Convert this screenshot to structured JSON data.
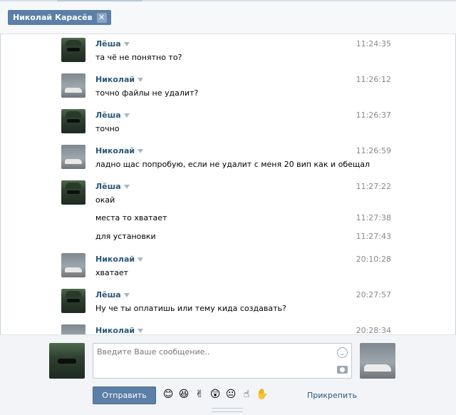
{
  "chat": {
    "tab_label": "Николай Карасёв",
    "close_glyph": "✕"
  },
  "messages": [
    {
      "author": "Лёша",
      "text": "та чё не понятно то?",
      "time": "11:24:35"
    },
    {
      "author": "Николай",
      "text": "точно файлы не удалит?",
      "time": "11:26:12"
    },
    {
      "author": "Лёша",
      "text": "точно",
      "time": "11:26:37"
    },
    {
      "author": "Николай",
      "text": "ладно щас попробую, если не удалит с меня 20 вип как и обещал",
      "time": "11:26:59"
    },
    {
      "author": "Лёша",
      "text": "окай",
      "time": "11:27:22"
    },
    {
      "author": "",
      "text": "места то хватает",
      "time": "11:27:38"
    },
    {
      "author": "",
      "text": "для установки",
      "time": "11:27:43"
    },
    {
      "author": "Николай",
      "text": "хватает",
      "time": "20:10:28"
    },
    {
      "author": "Лёша",
      "text": "Ну че ты оплатишь или тему кида создавать?",
      "time": "20:27:57"
    },
    {
      "author": "Николай",
      "text": "",
      "time": "20:28:34"
    }
  ],
  "composer": {
    "placeholder": "Введите Ваше сообщение..",
    "send_label": "Отправить",
    "attach_label": "Прикрепить",
    "emojis": [
      "😊",
      "😆",
      "✌",
      "😲",
      "😐",
      "☝",
      "✋"
    ]
  },
  "colors": {
    "accent": "#5b7fa6",
    "author_name": "#2b587a",
    "timestamp": "#8a8a8a"
  }
}
